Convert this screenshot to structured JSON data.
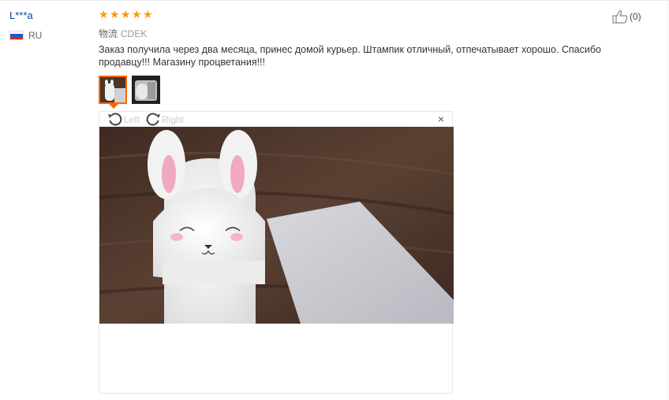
{
  "review": {
    "user_name": "L***a",
    "country_code": "RU",
    "rating": 5,
    "like_count": "(0)",
    "logistics_label": "物流",
    "logistics_value": "CDEK",
    "text": "Заказ получила через два месяца, принес домой курьер. Штампик отличный, отпечатывает хорошо. Спасибо продавцу!!! Магазину процветания!!!"
  },
  "viewer": {
    "rotate_left_label": "Left",
    "rotate_right_label": "Right",
    "close_symbol": "×"
  },
  "colors": {
    "username": "#0645ad",
    "star": "#ff9900",
    "active_thumb_border": "#ff6600"
  },
  "icons": {
    "like": "thumbs-up-icon",
    "rotate_left": "rotate-left-icon",
    "rotate_right": "rotate-right-icon",
    "close": "close-icon",
    "flag": "russia-flag-icon",
    "star": "star-icon"
  }
}
